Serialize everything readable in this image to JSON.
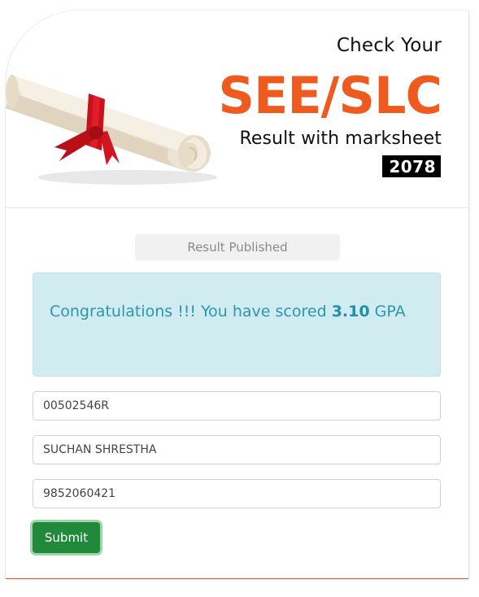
{
  "banner": {
    "line1": "Check Your",
    "line2": "SEE/SLC",
    "line3": "Result with marksheet",
    "year": "2078",
    "scroll_icon": "diploma-scroll-icon"
  },
  "status": {
    "label": "Result Published"
  },
  "result": {
    "message_prefix": "Congratulations !!! You have scored ",
    "gpa": "3.10",
    "message_suffix": " GPA"
  },
  "form": {
    "symbol_number": "00502546R",
    "name": "SUCHAN SHRESTHA",
    "phone": "9852060421",
    "submit_label": "Submit"
  },
  "colors": {
    "accent": "#ef5a1e",
    "alert_bg": "#d1ecf1",
    "alert_text": "#2a96b0",
    "submit_bg": "#208a3a"
  }
}
